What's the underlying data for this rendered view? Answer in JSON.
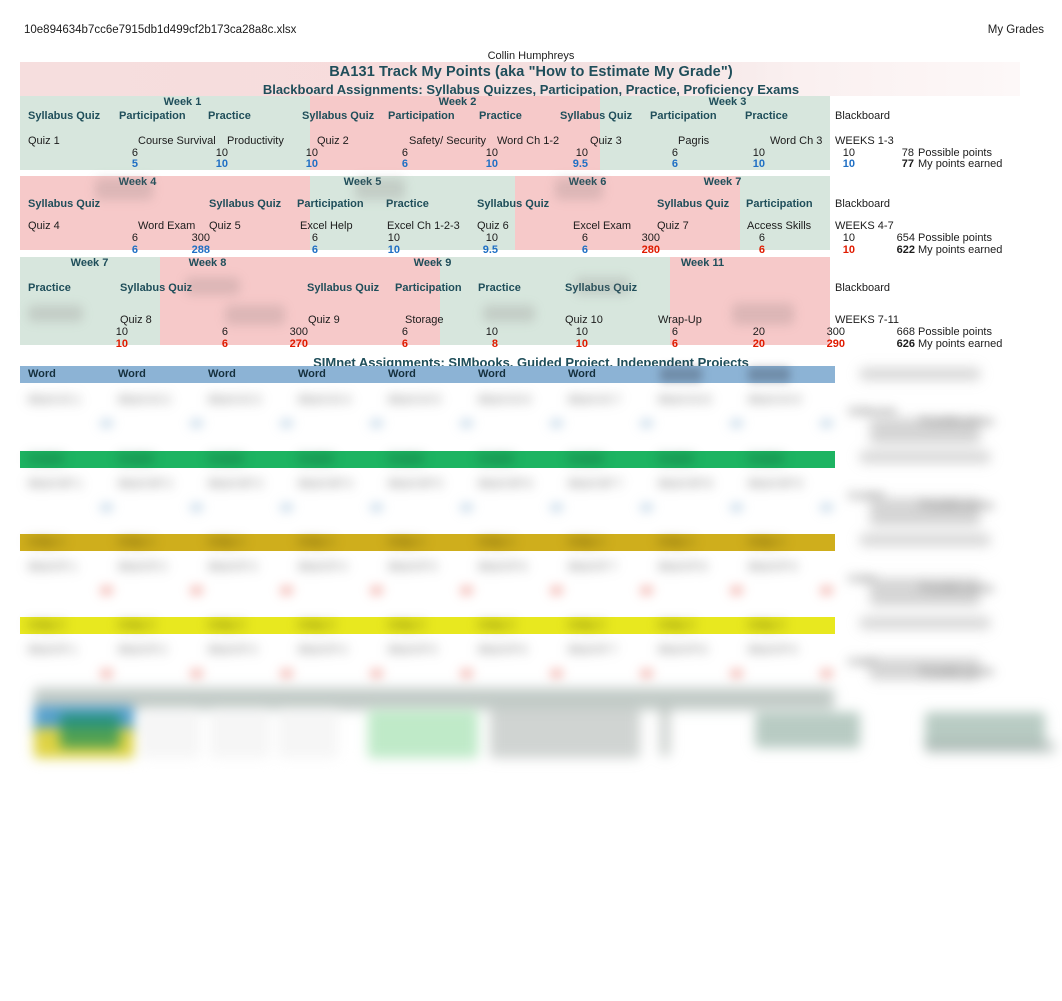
{
  "print_header": {
    "file_name": "10e894634b7cc6e7915db1d499cf2b173ca28a8c.xlsx",
    "sheet_name": "My Grades"
  },
  "author": "Collin Humphreys",
  "titles": {
    "main": "BA131 Track My Points (aka \"How to Estimate My Grade\")",
    "sub": "Blackboard Assignments: Syllabus Quizzes, Participation, Practice, Proficiency Exams",
    "simnet": "SIMnet Assignments: SIMbooks, Guided Project, Independent Projects"
  },
  "labels": {
    "syllabus_quiz": "Syllabus Quiz",
    "participation": "Participation",
    "practice": "Practice",
    "blackboard": "Blackboard",
    "possible_points": "Possible points",
    "points_earned": "My points earned",
    "word": "Word"
  },
  "blocks": [
    {
      "id": "weeks-1-3",
      "weeks": [
        "Week 1",
        "Week 2",
        "Week 3"
      ],
      "headers": [
        "Syllabus Quiz",
        "Participation",
        "Practice",
        "Syllabus Quiz",
        "Participation",
        "Practice",
        "Syllabus Quiz",
        "Participation",
        "Practice",
        "Blackboard"
      ],
      "items": [
        "Quiz 1",
        "Course Survival",
        "Productivity",
        "Quiz 2",
        "Safety/ Security",
        "Word Ch 1-2",
        "Quiz 3",
        "Pagris",
        "Word Ch 3",
        "WEEKS 1-3"
      ],
      "possible": [
        "6",
        "10",
        "10",
        "6",
        "10",
        "10",
        "6",
        "10",
        "10"
      ],
      "earned": [
        "5",
        "10",
        "10",
        "6",
        "10",
        "9.5",
        "6",
        "10",
        "10"
      ],
      "earned_color": [
        "blue",
        "blue",
        "blue",
        "blue",
        "blue",
        "blue",
        "blue",
        "blue",
        "blue"
      ],
      "total_possible": "78",
      "total_earned": "77"
    },
    {
      "id": "weeks-4-7",
      "weeks": [
        "Week 4",
        "Week 5",
        "Week 6",
        "Week 7"
      ],
      "headers": [
        "Syllabus Quiz",
        "",
        "Syllabus Quiz",
        "Participation",
        "Practice",
        "Syllabus Quiz",
        "",
        "Syllabus Quiz",
        "Participation",
        "Blackboard"
      ],
      "items": [
        "Quiz 4",
        "Word Exam",
        "Quiz 5",
        "Excel Help",
        "Excel Ch 1-2-3",
        "Quiz 6",
        "Excel Exam",
        "Quiz 7",
        "Access Skills",
        "WEEKS 4-7"
      ],
      "possible": [
        "6",
        "300",
        "6",
        "10",
        "10",
        "6",
        "300",
        "6",
        "10"
      ],
      "earned": [
        "6",
        "288",
        "6",
        "10",
        "9.5",
        "6",
        "280",
        "6",
        "10"
      ],
      "earned_color": [
        "blue",
        "blue",
        "blue",
        "blue",
        "blue",
        "blue",
        "red",
        "red",
        "red"
      ],
      "total_possible": "654",
      "total_earned": "622"
    },
    {
      "id": "weeks-7-11",
      "weeks": [
        "Week 7",
        "Week 8",
        "Week 9",
        "Week 11"
      ],
      "headers": [
        "Practice",
        "Syllabus Quiz",
        "",
        "Syllabus Quiz",
        "Participation",
        "Practice",
        "Syllabus Quiz",
        "",
        "",
        "Blackboard"
      ],
      "items": [
        "",
        "Quiz 8",
        "",
        "Quiz 9",
        "Storage",
        "",
        "Quiz 10",
        "Wrap-Up",
        "",
        "WEEKS 7-11"
      ],
      "possible": [
        "10",
        "6",
        "300",
        "6",
        "10",
        "10",
        "6",
        "20",
        "300"
      ],
      "earned": [
        "10",
        "6",
        "270",
        "6",
        "8",
        "10",
        "6",
        "20",
        "290"
      ],
      "earned_color": [
        "red",
        "red",
        "red",
        "red",
        "red",
        "red",
        "red",
        "red",
        "red"
      ],
      "total_possible": "668",
      "total_earned": "626"
    }
  ],
  "simnet": {
    "group_rows": [
      {
        "id": "simbook-row",
        "color": "#8cb3d5",
        "labels": [
          "Word",
          "Word",
          "Word",
          "Word",
          "Word",
          "Word",
          "Word",
          "",
          ""
        ]
      },
      {
        "id": "guided-row",
        "color": "#1db462",
        "labels": [
          "",
          "",
          "",
          "",
          "",
          "",
          "",
          "",
          ""
        ]
      },
      {
        "id": "independent-row-1",
        "color": "#cfae1c",
        "labels": [
          "",
          "",
          "",
          "",
          "",
          "",
          "",
          "",
          ""
        ]
      },
      {
        "id": "independent-row-2",
        "color": "#e8e81f",
        "labels": [
          "",
          "",
          "",
          "",
          "",
          "",
          "",
          "",
          ""
        ]
      }
    ]
  }
}
